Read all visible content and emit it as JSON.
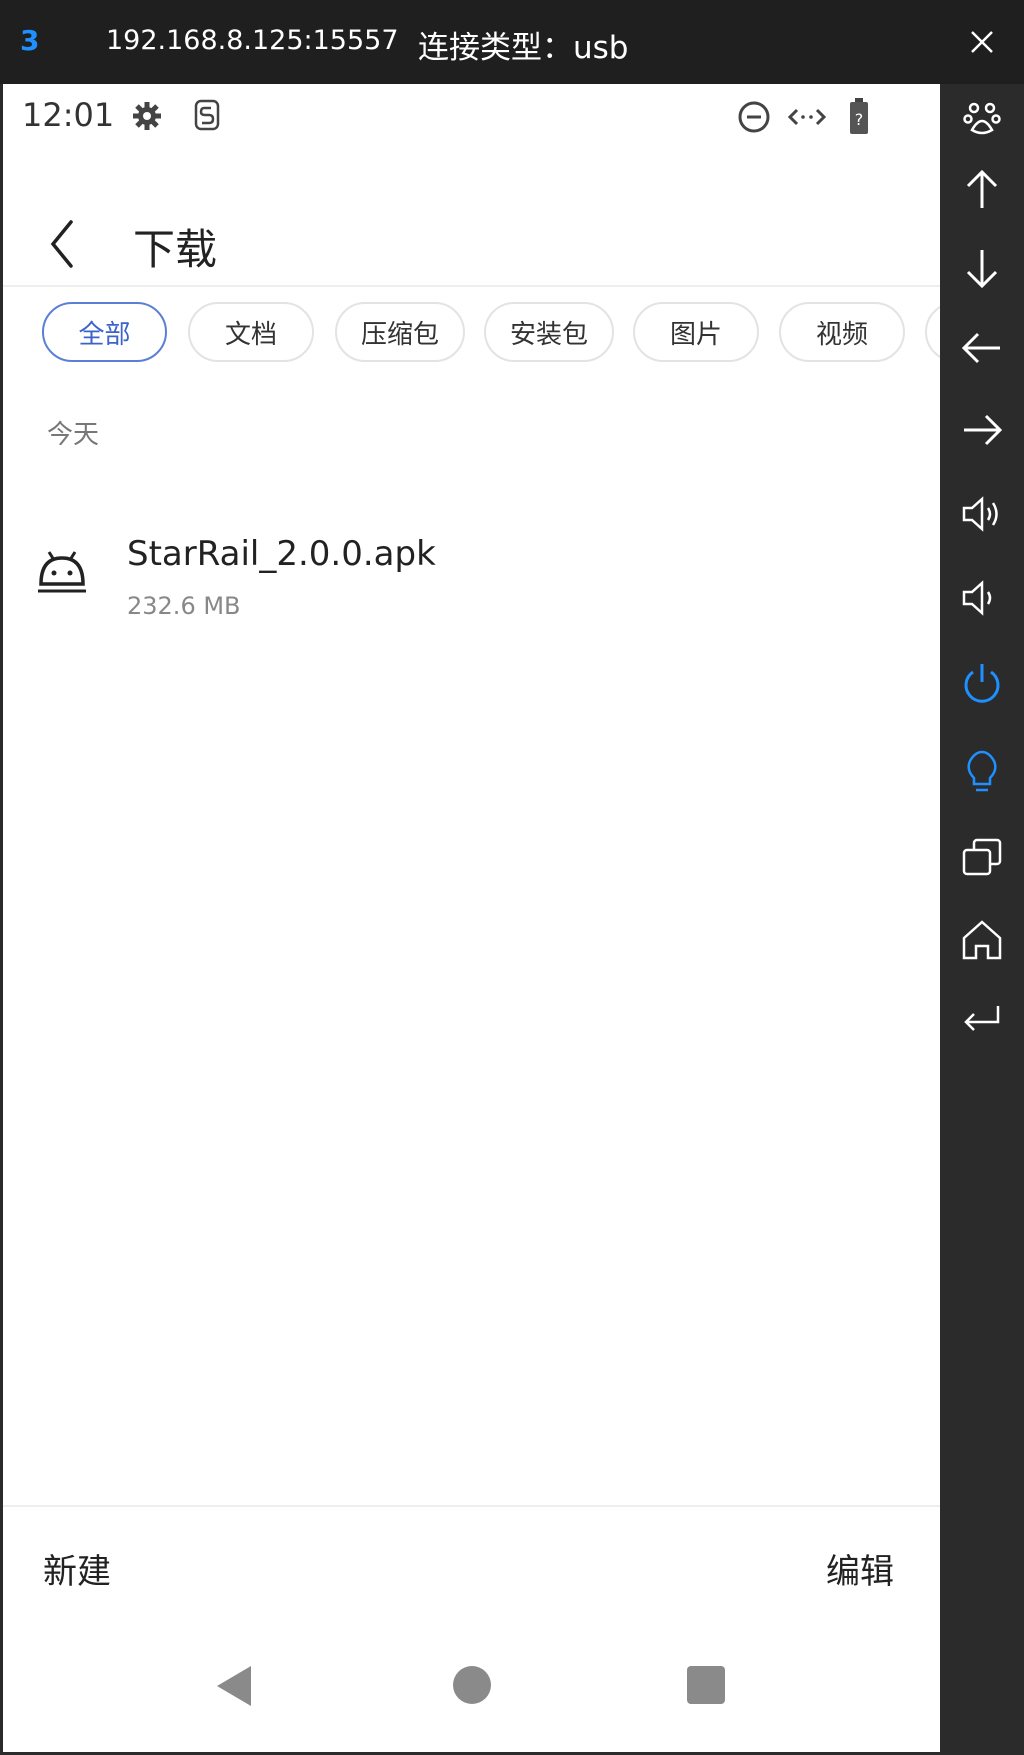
{
  "window": {
    "number": "3",
    "address": "192.168.8.125:15557",
    "connection": "连接类型：usb"
  },
  "status_bar": {
    "time": "12:01"
  },
  "app_bar": {
    "title": "下载"
  },
  "filters": [
    {
      "label": "全部",
      "active": true
    },
    {
      "label": "文档",
      "active": false
    },
    {
      "label": "压缩包",
      "active": false
    },
    {
      "label": "安装包",
      "active": false
    },
    {
      "label": "图片",
      "active": false
    },
    {
      "label": "视频",
      "active": false
    }
  ],
  "section": {
    "label": "今天"
  },
  "files": [
    {
      "name": "StarRail_2.0.0.apk",
      "size": "232.6 MB",
      "icon": "android-icon"
    }
  ],
  "bottom_actions": {
    "new_label": "新建",
    "edit_label": "编辑"
  },
  "sidebar_tools": [
    "paw-icon",
    "arrow-up-icon",
    "arrow-down-icon",
    "arrow-left-icon",
    "arrow-right-icon",
    "volume-up-icon",
    "volume-down-icon",
    "power-icon",
    "bulb-icon",
    "windows-icon",
    "home-icon",
    "return-icon"
  ],
  "colors": {
    "accent": "#1e90ff",
    "chip_active": "#3b63c9",
    "sidebar_bg": "#2b2b2b",
    "titlebar_bg": "#1f1f1f"
  }
}
